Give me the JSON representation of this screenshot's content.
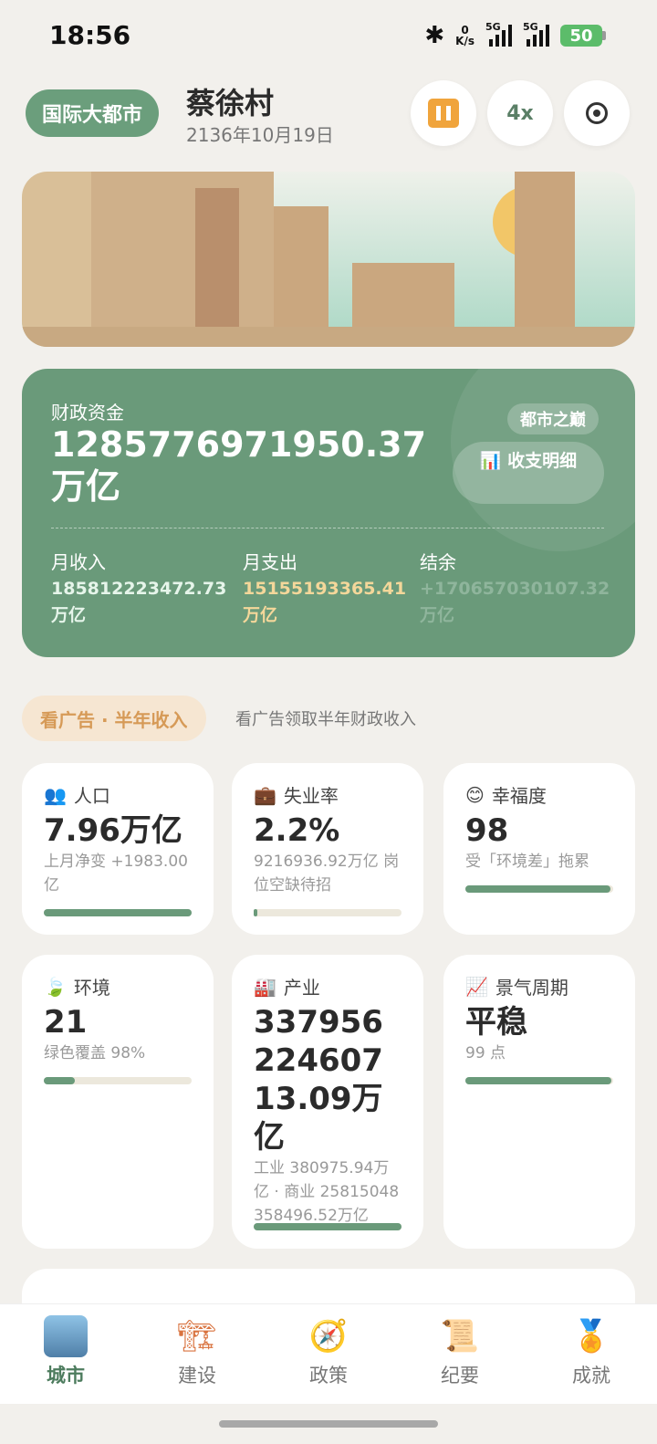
{
  "status": {
    "time": "18:56",
    "net_speed_top": "0",
    "net_speed_unit": "K/s",
    "sig1_label": "5G",
    "sig2_label": "5G",
    "battery": "50"
  },
  "header": {
    "city_tag": "国际大都市",
    "city_name": "蔡徐村",
    "date": "2136年10月19日",
    "speed_label": "4x"
  },
  "finance": {
    "label": "财政资金",
    "value": "1285776971950.37万亿",
    "peak_badge": "都市之巅",
    "detail_btn": "📊 收支明细",
    "income_label": "月收入",
    "income_value": "185812223472.73",
    "income_unit": "万亿",
    "expense_label": "月支出",
    "expense_value": "15155193365.41",
    "expense_unit": "万亿",
    "balance_label": "结余",
    "balance_value": "+170657030107.32",
    "balance_unit": "万亿"
  },
  "ad": {
    "button": "看广告 · 半年收入",
    "hint": "看广告领取半年财政收入"
  },
  "stats": {
    "population": {
      "icon": "👥",
      "title": "人口",
      "value": "7.96万亿",
      "sub": "上月净变 +1983.00亿",
      "progress": 1.0
    },
    "unemployment": {
      "icon": "💼",
      "title": "失业率",
      "value": "2.2%",
      "sub": "9216936.92万亿 岗位空缺待招",
      "progress": 0.022
    },
    "happiness": {
      "icon": "😊",
      "title": "幸福度",
      "value": "98",
      "sub": "受「环境差」拖累",
      "progress": 0.98
    },
    "environment": {
      "icon": "🍃",
      "title": "环境",
      "value": "21",
      "sub": "绿色覆盖 98%",
      "progress": 0.21
    },
    "industry": {
      "icon": "🏭",
      "title": "产业",
      "value": "33795622460713.09万亿",
      "sub": "工业 380975.94万亿 · 商业 25815048358496.52万亿",
      "progress": 1.0
    },
    "cycle": {
      "icon": "📈",
      "title": "景气周期",
      "value": "平稳",
      "sub": "99 点",
      "progress": 0.99
    }
  },
  "nav": {
    "items": [
      {
        "label": "城市",
        "icon": "city-icon"
      },
      {
        "label": "建设",
        "icon": "crane-icon"
      },
      {
        "label": "政策",
        "icon": "compass-icon"
      },
      {
        "label": "纪要",
        "icon": "scroll-icon"
      },
      {
        "label": "成就",
        "icon": "medal-icon"
      }
    ]
  },
  "colors": {
    "accent": "#6a9a7a",
    "warning": "#f0a43c",
    "expense": "#f4d79a"
  }
}
